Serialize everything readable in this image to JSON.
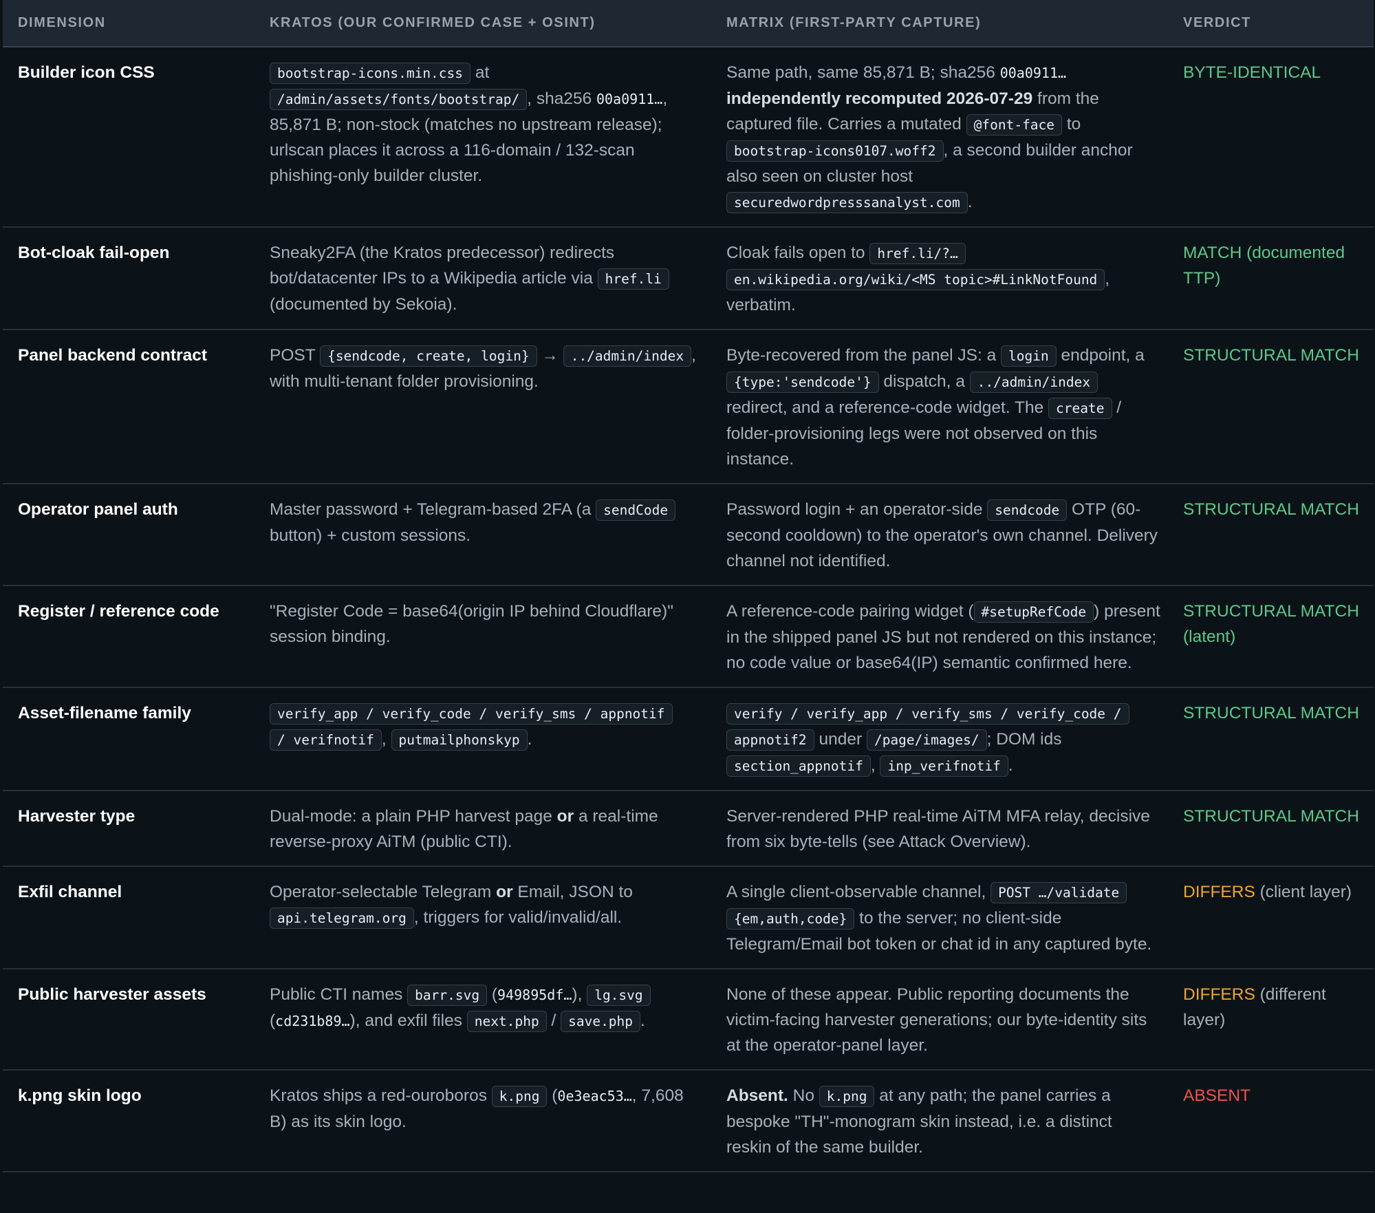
{
  "headers": {
    "dimension": "DIMENSION",
    "kratos": "KRATOS (OUR CONFIRMED CASE + OSINT)",
    "matrix": "MATRIX (FIRST-PARTY CAPTURE)",
    "verdict": "VERDICT"
  },
  "colors": {
    "match": "#5cc98a",
    "differs": "#f0a42e",
    "absent": "#f0504a"
  },
  "rows": [
    {
      "dimension": "Builder icon CSS",
      "kratos": [
        {
          "t": "code",
          "v": "bootstrap-icons.min.css"
        },
        {
          "t": "text",
          "v": " at "
        },
        {
          "t": "code",
          "v": "/admin/assets/fonts/bootstrap/"
        },
        {
          "t": "text",
          "v": ", sha256 "
        },
        {
          "t": "mono",
          "v": "00a0911…"
        },
        {
          "t": "text",
          "v": ", 85,871 B; non-stock (matches no upstream release); urlscan places it across a 116-domain / 132-scan phishing-only builder cluster."
        }
      ],
      "matrix": [
        {
          "t": "text",
          "v": "Same path, same 85,871 B; sha256 "
        },
        {
          "t": "mono",
          "v": "00a0911…"
        },
        {
          "t": "text",
          "v": " "
        },
        {
          "t": "bold",
          "v": "independently recomputed 2026-07-29"
        },
        {
          "t": "text",
          "v": " from the captured file. Carries a mutated "
        },
        {
          "t": "code",
          "v": "@font-face"
        },
        {
          "t": "text",
          "v": " to "
        },
        {
          "t": "code",
          "v": "bootstrap-icons0107.woff2"
        },
        {
          "t": "text",
          "v": ", a second builder anchor also seen on cluster host "
        },
        {
          "t": "code",
          "v": "securedwordpresssanalyst.com"
        },
        {
          "t": "text",
          "v": "."
        }
      ],
      "verdict": [
        {
          "t": "green",
          "v": "BYTE-IDENTICAL"
        }
      ]
    },
    {
      "dimension": "Bot-cloak fail-open",
      "kratos": [
        {
          "t": "text",
          "v": "Sneaky2FA (the Kratos predecessor) redirects bot/datacenter IPs to a Wikipedia article via "
        },
        {
          "t": "code",
          "v": "href.li"
        },
        {
          "t": "text",
          "v": " (documented by Sekoia)."
        }
      ],
      "matrix": [
        {
          "t": "text",
          "v": "Cloak fails open to "
        },
        {
          "t": "code",
          "v": "href.li/?…"
        },
        {
          "t": "text",
          "v": " "
        },
        {
          "t": "code",
          "v": "en.wikipedia.org/wiki/<MS topic>#LinkNotFound"
        },
        {
          "t": "text",
          "v": ", verbatim."
        }
      ],
      "verdict": [
        {
          "t": "green",
          "v": "MATCH (documented TTP)"
        }
      ]
    },
    {
      "dimension": "Panel backend contract",
      "kratos": [
        {
          "t": "text",
          "v": "POST "
        },
        {
          "t": "code",
          "v": "{sendcode, create, login}"
        },
        {
          "t": "text",
          "v": " → "
        },
        {
          "t": "code",
          "v": "../admin/index"
        },
        {
          "t": "text",
          "v": ", with multi-tenant folder provisioning."
        }
      ],
      "matrix": [
        {
          "t": "text",
          "v": "Byte-recovered from the panel JS: a "
        },
        {
          "t": "code",
          "v": "login"
        },
        {
          "t": "text",
          "v": " endpoint, a "
        },
        {
          "t": "code",
          "v": "{type:'sendcode'}"
        },
        {
          "t": "text",
          "v": " dispatch, a "
        },
        {
          "t": "code",
          "v": "../admin/index"
        },
        {
          "t": "text",
          "v": " redirect, and a reference-code widget. The "
        },
        {
          "t": "code",
          "v": "create"
        },
        {
          "t": "text",
          "v": " / folder-provisioning legs were not observed on this instance."
        }
      ],
      "verdict": [
        {
          "t": "green",
          "v": "STRUCTURAL MATCH"
        }
      ]
    },
    {
      "dimension": "Operator panel auth",
      "kratos": [
        {
          "t": "text",
          "v": "Master password + Telegram-based 2FA (a "
        },
        {
          "t": "code",
          "v": "sendCode"
        },
        {
          "t": "text",
          "v": " button) + custom sessions."
        }
      ],
      "matrix": [
        {
          "t": "text",
          "v": "Password login + an operator-side "
        },
        {
          "t": "code",
          "v": "sendcode"
        },
        {
          "t": "text",
          "v": " OTP (60-second cooldown) to the operator's own channel. Delivery channel not identified."
        }
      ],
      "verdict": [
        {
          "t": "green",
          "v": "STRUCTURAL MATCH"
        }
      ]
    },
    {
      "dimension": "Register / reference code",
      "kratos": [
        {
          "t": "text",
          "v": "\"Register Code = base64(origin IP behind Cloudflare)\" session binding."
        }
      ],
      "matrix": [
        {
          "t": "text",
          "v": "A reference-code pairing widget ("
        },
        {
          "t": "code",
          "v": "#setupRefCode"
        },
        {
          "t": "text",
          "v": ") present in the shipped panel JS but not rendered on this instance; no code value or base64(IP) semantic confirmed here."
        }
      ],
      "verdict": [
        {
          "t": "green",
          "v": "STRUCTURAL MATCH (latent)"
        }
      ]
    },
    {
      "dimension": "Asset-filename family",
      "kratos": [
        {
          "t": "code",
          "v": "verify_app / verify_code / verify_sms / appnotif"
        },
        {
          "t": "text",
          "v": " "
        },
        {
          "t": "code",
          "v": "/ verifnotif"
        },
        {
          "t": "text",
          "v": ", "
        },
        {
          "t": "code",
          "v": "putmailphonskyp"
        },
        {
          "t": "text",
          "v": "."
        }
      ],
      "matrix": [
        {
          "t": "code",
          "v": "verify / verify_app / verify_sms / verify_code /"
        },
        {
          "t": "text",
          "v": " "
        },
        {
          "t": "code",
          "v": "appnotif2"
        },
        {
          "t": "text",
          "v": " under "
        },
        {
          "t": "code",
          "v": "/page/images/"
        },
        {
          "t": "text",
          "v": "; DOM ids "
        },
        {
          "t": "code",
          "v": "section_appnotif"
        },
        {
          "t": "text",
          "v": ", "
        },
        {
          "t": "code",
          "v": "inp_verifnotif"
        },
        {
          "t": "text",
          "v": "."
        }
      ],
      "verdict": [
        {
          "t": "green",
          "v": "STRUCTURAL MATCH"
        }
      ]
    },
    {
      "dimension": "Harvester type",
      "kratos": [
        {
          "t": "text",
          "v": "Dual-mode: a plain PHP harvest page "
        },
        {
          "t": "bold",
          "v": "or"
        },
        {
          "t": "text",
          "v": " a real-time reverse-proxy AiTM (public CTI)."
        }
      ],
      "matrix": [
        {
          "t": "text",
          "v": "Server-rendered PHP real-time AiTM MFA relay, decisive from six byte-tells (see Attack Overview)."
        }
      ],
      "verdict": [
        {
          "t": "green",
          "v": "STRUCTURAL MATCH"
        }
      ]
    },
    {
      "dimension": "Exfil channel",
      "kratos": [
        {
          "t": "text",
          "v": "Operator-selectable Telegram "
        },
        {
          "t": "bold",
          "v": "or"
        },
        {
          "t": "text",
          "v": " Email, JSON to "
        },
        {
          "t": "code",
          "v": "api.telegram.org"
        },
        {
          "t": "text",
          "v": ", triggers for valid/invalid/all."
        }
      ],
      "matrix": [
        {
          "t": "text",
          "v": "A single client-observable channel, "
        },
        {
          "t": "code",
          "v": "POST …/validate"
        },
        {
          "t": "text",
          "v": " "
        },
        {
          "t": "code",
          "v": "{em,auth,code}"
        },
        {
          "t": "text",
          "v": " to the server; no client-side Telegram/Email bot token or chat id in any captured byte."
        }
      ],
      "verdict": [
        {
          "t": "amber",
          "v": "DIFFERS"
        },
        {
          "t": "text",
          "v": " (client layer)"
        }
      ]
    },
    {
      "dimension": "Public harvester assets",
      "kratos": [
        {
          "t": "text",
          "v": "Public CTI names "
        },
        {
          "t": "code",
          "v": "barr.svg"
        },
        {
          "t": "text",
          "v": " ("
        },
        {
          "t": "mono",
          "v": "949895df…"
        },
        {
          "t": "text",
          "v": "), "
        },
        {
          "t": "code",
          "v": "lg.svg"
        },
        {
          "t": "text",
          "v": " ("
        },
        {
          "t": "mono",
          "v": "cd231b89…"
        },
        {
          "t": "text",
          "v": "), and exfil files "
        },
        {
          "t": "code",
          "v": "next.php"
        },
        {
          "t": "text",
          "v": " / "
        },
        {
          "t": "code",
          "v": "save.php"
        },
        {
          "t": "text",
          "v": "."
        }
      ],
      "matrix": [
        {
          "t": "text",
          "v": "None of these appear. Public reporting documents the victim-facing harvester generations; our byte-identity sits at the operator-panel layer."
        }
      ],
      "verdict": [
        {
          "t": "amber",
          "v": "DIFFERS"
        },
        {
          "t": "text",
          "v": " (different layer)"
        }
      ]
    },
    {
      "dimension": "k.png skin logo",
      "kratos": [
        {
          "t": "text",
          "v": "Kratos ships a red-ouroboros "
        },
        {
          "t": "code",
          "v": "k.png"
        },
        {
          "t": "text",
          "v": " ("
        },
        {
          "t": "mono",
          "v": "0e3eac53…"
        },
        {
          "t": "text",
          "v": ", 7,608 B) as its skin logo."
        }
      ],
      "matrix": [
        {
          "t": "bold",
          "v": "Absent."
        },
        {
          "t": "text",
          "v": " No "
        },
        {
          "t": "code",
          "v": "k.png"
        },
        {
          "t": "text",
          "v": " at any path; the panel carries a bespoke \"TH\"-monogram skin instead, i.e. a distinct reskin of the same builder."
        }
      ],
      "verdict": [
        {
          "t": "red",
          "v": "ABSENT"
        }
      ]
    }
  ]
}
